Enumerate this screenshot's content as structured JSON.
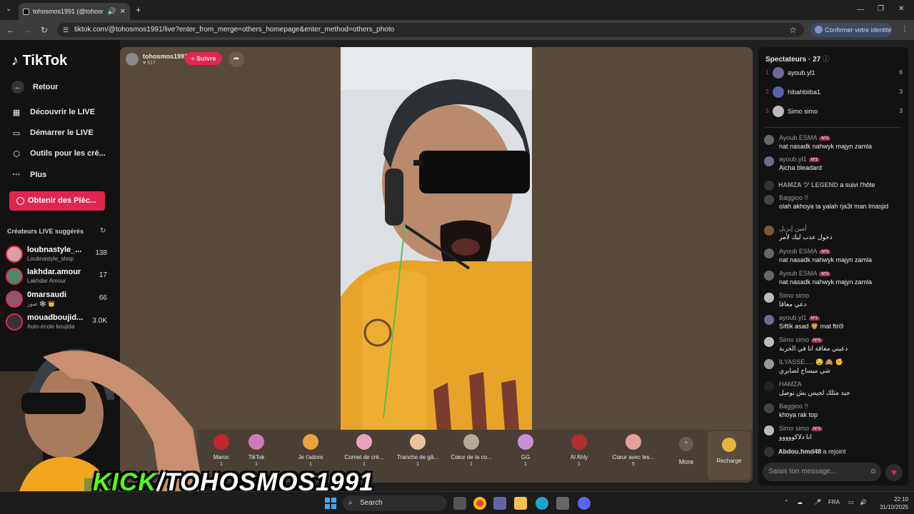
{
  "browser": {
    "tab_title": "tohosmos1991 (@tohosmo",
    "new_tab": "+",
    "url": "tiktok.com/@tohosmos1991/live?enter_from_merge=others_homepage&enter_method=others_photo",
    "identity_pill": "Confirmer votre identité"
  },
  "sidebar": {
    "logo": "TikTok",
    "back": "Retour",
    "nav": [
      {
        "label": "Découvrir le LIVE",
        "icon": "calendar-icon"
      },
      {
        "label": "Démarrer le LIVE",
        "icon": "camera-icon"
      },
      {
        "label": "Outils pour les cré...",
        "icon": "tools-icon"
      },
      {
        "label": "Plus",
        "icon": "more-icon"
      }
    ],
    "coins_button": "Obtenir des Pièc...",
    "suggested_title": "Créateurs LIVE suggérés",
    "creators": [
      {
        "name": "loubnastyle_...",
        "sub": "Loubnastyle_shop",
        "count": "138"
      },
      {
        "name": "lakhdar.amour",
        "sub": "Lakhdar Amour",
        "count": "17"
      },
      {
        "name": "0marsaudi",
        "sub": "صور ❄️ 👑",
        "count": "66"
      },
      {
        "name": "mouadboujid...",
        "sub": "Auto-école boujida",
        "count": "3.0K"
      }
    ]
  },
  "live": {
    "host_name": "tohosmos1991",
    "host_likes": "517",
    "follow": "+ Suivre",
    "gifts": [
      {
        "name": "Maroc",
        "price": "1"
      },
      {
        "name": "TikTok",
        "price": "1"
      },
      {
        "name": "Je t'adore",
        "price": "1"
      },
      {
        "name": "Cornet de crè...",
        "price": "1"
      },
      {
        "name": "Tranche de gâ...",
        "price": "1"
      },
      {
        "name": "Cœur de la co...",
        "price": "1"
      },
      {
        "name": "GG",
        "price": "1"
      },
      {
        "name": "Al Ahly",
        "price": "1"
      },
      {
        "name": "Cœur avec les...",
        "price": "5"
      }
    ],
    "more": "More",
    "recharge": "Recharge"
  },
  "chat_panel": {
    "spectators_title": "Spectateurs · 27",
    "ranking": [
      {
        "rank": "1",
        "name": "ayoub.yl1",
        "score": "6"
      },
      {
        "rank": "2",
        "name": "hibahbiiba1",
        "score": "3"
      },
      {
        "rank": "3",
        "name": "Simo simo",
        "score": "3"
      }
    ],
    "messages": [
      {
        "user": "Ayoub ESMA",
        "badge": "Nº3",
        "text": "nat nasadk nahwyk majyn zamla"
      },
      {
        "user": "ayoub.yl1",
        "badge": "Nº1",
        "text": "Aicha bleadard"
      },
      {
        "user": "Baggioo !!",
        "badge": "",
        "text": "olah akhoya ta yalah rja3t man lmasjid"
      },
      {
        "user": "أمين إيزيل",
        "badge": "",
        "text": "دحول عدب ليك لأمر"
      },
      {
        "user": "Ayoub ESMA",
        "badge": "Nº3",
        "text": "nat nasadk nahwyk majyn zamla"
      },
      {
        "user": "Ayoub ESMA",
        "badge": "Nº3",
        "text": "nat nasadk nahwyk majyn zamla"
      },
      {
        "user": "Simo simo",
        "badge": "",
        "text": "دعي معاقا"
      },
      {
        "user": "ayoub.yl1",
        "badge": "Nº1",
        "text": "Siftlk asad 🦁 mat ftri9"
      },
      {
        "user": "Simo simo",
        "badge": "Nº3",
        "text": "دعيني معاقة انا في الخربة"
      },
      {
        "user": "ILYASSE..... 🤤 🙈 ✊",
        "badge": "",
        "text": "شي ميساج لصابري"
      },
      {
        "user": "HAMZA",
        "badge": "",
        "text": "جيد مثلك لحيس بش نوصل"
      },
      {
        "user": "Baggioo !!",
        "badge": "",
        "text": "khoya rak top"
      },
      {
        "user": "Simo simo",
        "badge": "Nº3",
        "text": "انا دلاكووووو"
      }
    ],
    "follow_event": {
      "user": "HAMZA ツ LEGEND",
      "text": "a suivi l'hôte"
    },
    "join_event": {
      "user": "Abdou.hmd48",
      "text": "a rejoint"
    },
    "input_placeholder": "Saisis ton message..."
  },
  "overlay": {
    "kick_prefix": "KICK",
    "kick_rest": "/TOHOSMOS1991"
  },
  "taskbar": {
    "search": "Search",
    "lang": "FRA",
    "time": "22:10",
    "date": "31/10/2025"
  }
}
